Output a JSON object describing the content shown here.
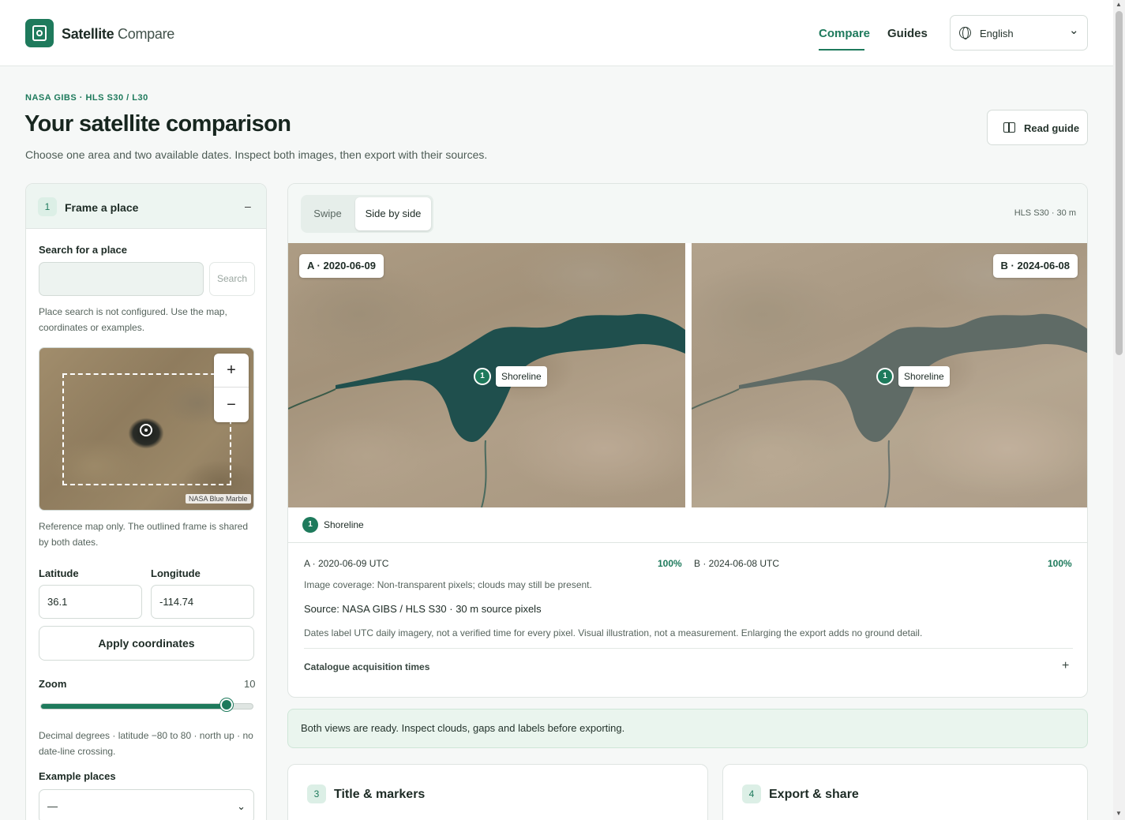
{
  "app": {
    "brand_bold": "Satellite",
    "brand_light": "Compare",
    "nav": {
      "compare": "Compare",
      "guides": "Guides"
    },
    "language": "English"
  },
  "intro": {
    "eyebrow": "NASA GIBS · HLS S30 / L30",
    "title": "Your satellite comparison",
    "subtitle": "Choose one area and two available dates. Inspect both images, then export with their sources.",
    "guide_button": "Read guide"
  },
  "frame_panel": {
    "step": "1",
    "title": "Frame a place",
    "collapse": "–",
    "search_label": "Search for a place",
    "search_value": "",
    "search_button": "Search",
    "search_hint": "Place search is not configured. Use the map, coordinates or examples.",
    "map_attribution": "NASA Blue Marble",
    "zoom_in": "+",
    "zoom_out": "−",
    "map_hint": "Reference map only. The outlined frame is shared by both dates.",
    "latitude_label": "Latitude",
    "latitude_value": "36.1",
    "longitude_label": "Longitude",
    "longitude_value": "-114.74",
    "apply_button": "Apply coordinates",
    "zoom_label": "Zoom",
    "zoom_value": "10",
    "zoom_level_fraction": 0.88,
    "coord_hint": "Decimal degrees · latitude −80 to 80 · north up · no date-line crossing.",
    "examples_label": "Example places",
    "examples_selected": "—"
  },
  "compare": {
    "modes": {
      "swipe": "Swipe",
      "side": "Side by side"
    },
    "active_mode": "Side by side",
    "resolution": "HLS S30 · 30 m",
    "pane_a_label": "A · 2020-06-09",
    "pane_b_label": "B · 2024-06-08",
    "marker_number": "1",
    "marker_label": "Shoreline",
    "legend_number": "1",
    "legend_label": "Shoreline",
    "a_date_utc": "A · 2020-06-09 UTC",
    "a_coverage": "100%",
    "b_date_utc": "B · 2024-06-08 UTC",
    "b_coverage": "100%",
    "coverage_note": "Image coverage: Non-transparent pixels; clouds may still be present.",
    "source": "Source: NASA GIBS / HLS S30 · 30 m source pixels",
    "disclaimer": "Dates label UTC daily imagery, not a verified time for every pixel. Visual illustration, not a measurement. Enlarging the export adds no ground detail.",
    "catalogue": "Catalogue acquisition times",
    "catalogue_toggle": "+",
    "lake_color_a": "#1f4f4d",
    "lake_color_b": "#5f6b66"
  },
  "status": "Both views are ready. Inspect clouds, gaps and labels before exporting.",
  "cards": [
    {
      "step": "3",
      "title": "Title & markers"
    },
    {
      "step": "4",
      "title": "Export & share"
    }
  ],
  "colors": {
    "accent": "#1e7a5c"
  }
}
